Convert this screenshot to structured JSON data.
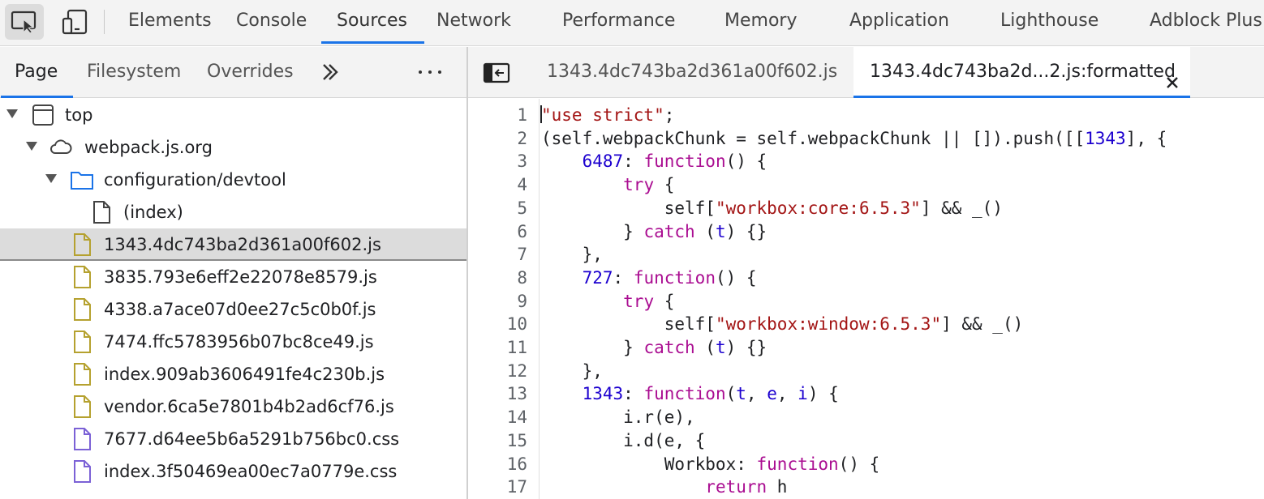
{
  "colors": {
    "accent": "#1a73e8",
    "js_file_icon": "#b5a12f",
    "css_file_icon": "#7b61d6",
    "folder_icon": "#1a73e8",
    "string": "#a31515",
    "keyword": "#aa0d91",
    "number": "#1c00cf"
  },
  "toolbar": {
    "inspect_icon": "inspect-element-icon",
    "device_icon": "device-toolbar-icon",
    "tabs": [
      "Elements",
      "Console",
      "Sources",
      "Network",
      "Performance",
      "Memory",
      "Application",
      "Lighthouse",
      "Adblock Plus"
    ],
    "active_tab": "Sources"
  },
  "navigator": {
    "tabs": [
      "Page",
      "Filesystem",
      "Overrides"
    ],
    "active_tab": "Page",
    "more_icon": "chevron-double-right-icon",
    "menu_icon": "more-horizontal-icon",
    "tree": [
      {
        "label": "top",
        "icon": "frame-icon",
        "depth": 0,
        "expanded": true
      },
      {
        "label": "webpack.js.org",
        "icon": "cloud-icon",
        "depth": 1,
        "expanded": true
      },
      {
        "label": "configuration/devtool",
        "icon": "folder-icon",
        "depth": 2,
        "expanded": true
      },
      {
        "label": "(index)",
        "icon": "document-icon",
        "depth": 3
      },
      {
        "label": "1343.4dc743ba2d361a00f602.js",
        "icon": "js-file-icon",
        "depth": 2,
        "selected": true
      },
      {
        "label": "3835.793e6eff2e22078e8579.js",
        "icon": "js-file-icon",
        "depth": 2
      },
      {
        "label": "4338.a7ace07d0ee27c5c0b0f.js",
        "icon": "js-file-icon",
        "depth": 2
      },
      {
        "label": "7474.ffc5783956b07bc8ce49.js",
        "icon": "js-file-icon",
        "depth": 2
      },
      {
        "label": "index.909ab3606491fe4c230b.js",
        "icon": "js-file-icon",
        "depth": 2
      },
      {
        "label": "vendor.6ca5e7801b4b2ad6cf76.js",
        "icon": "js-file-icon",
        "depth": 2
      },
      {
        "label": "7677.d64ee5b6a5291b756bc0.css",
        "icon": "css-file-icon",
        "depth": 2
      },
      {
        "label": "index.3f50469ea00ec7a0779e.css",
        "icon": "css-file-icon",
        "depth": 2
      }
    ]
  },
  "editor": {
    "toggle_icon": "toggle-navigator-icon",
    "tabs": [
      {
        "label": "1343.4dc743ba2d361a00f602.js",
        "active": false
      },
      {
        "label": "1343.4dc743ba2d...2.js:formatted",
        "active": true
      }
    ],
    "close_icon": "close-icon",
    "lines": [
      {
        "n": "1",
        "tokens": [
          [
            "str",
            "\"use strict\""
          ],
          [
            "plain",
            ";"
          ]
        ]
      },
      {
        "n": "2",
        "tokens": [
          [
            "plain",
            "(self.webpackChunk = self.webpackChunk || []).push([["
          ],
          [
            "num",
            "1343"
          ],
          [
            "plain",
            "], {"
          ]
        ]
      },
      {
        "n": "3",
        "tokens": [
          [
            "plain",
            "    "
          ],
          [
            "num",
            "6487"
          ],
          [
            "plain",
            ": "
          ],
          [
            "kw",
            "function"
          ],
          [
            "plain",
            "() {"
          ]
        ]
      },
      {
        "n": "4",
        "tokens": [
          [
            "plain",
            "        "
          ],
          [
            "kw",
            "try"
          ],
          [
            "plain",
            " {"
          ]
        ]
      },
      {
        "n": "5",
        "tokens": [
          [
            "plain",
            "            self["
          ],
          [
            "str",
            "\"workbox:core:6.5.3\""
          ],
          [
            "plain",
            "] && _()"
          ]
        ]
      },
      {
        "n": "6",
        "tokens": [
          [
            "plain",
            "        } "
          ],
          [
            "kw",
            "catch"
          ],
          [
            "plain",
            " ("
          ],
          [
            "var",
            "t"
          ],
          [
            "plain",
            ") {}"
          ]
        ]
      },
      {
        "n": "7",
        "tokens": [
          [
            "plain",
            "    },"
          ]
        ]
      },
      {
        "n": "8",
        "tokens": [
          [
            "plain",
            "    "
          ],
          [
            "num",
            "727"
          ],
          [
            "plain",
            ": "
          ],
          [
            "kw",
            "function"
          ],
          [
            "plain",
            "() {"
          ]
        ]
      },
      {
        "n": "9",
        "tokens": [
          [
            "plain",
            "        "
          ],
          [
            "kw",
            "try"
          ],
          [
            "plain",
            " {"
          ]
        ]
      },
      {
        "n": "10",
        "tokens": [
          [
            "plain",
            "            self["
          ],
          [
            "str",
            "\"workbox:window:6.5.3\""
          ],
          [
            "plain",
            "] && _()"
          ]
        ]
      },
      {
        "n": "11",
        "tokens": [
          [
            "plain",
            "        } "
          ],
          [
            "kw",
            "catch"
          ],
          [
            "plain",
            " ("
          ],
          [
            "var",
            "t"
          ],
          [
            "plain",
            ") {}"
          ]
        ]
      },
      {
        "n": "12",
        "tokens": [
          [
            "plain",
            "    },"
          ]
        ]
      },
      {
        "n": "13",
        "tokens": [
          [
            "plain",
            "    "
          ],
          [
            "num",
            "1343"
          ],
          [
            "plain",
            ": "
          ],
          [
            "kw",
            "function"
          ],
          [
            "plain",
            "("
          ],
          [
            "var",
            "t"
          ],
          [
            "plain",
            ", "
          ],
          [
            "var",
            "e"
          ],
          [
            "plain",
            ", "
          ],
          [
            "var",
            "i"
          ],
          [
            "plain",
            ") {"
          ]
        ]
      },
      {
        "n": "14",
        "tokens": [
          [
            "plain",
            "        i.r(e),"
          ]
        ]
      },
      {
        "n": "15",
        "tokens": [
          [
            "plain",
            "        i.d(e, {"
          ]
        ]
      },
      {
        "n": "16",
        "tokens": [
          [
            "plain",
            "            Workbox: "
          ],
          [
            "kw",
            "function"
          ],
          [
            "plain",
            "() {"
          ]
        ]
      },
      {
        "n": "17",
        "tokens": [
          [
            "plain",
            "                "
          ],
          [
            "kw",
            "return"
          ],
          [
            "plain",
            " h"
          ]
        ]
      }
    ]
  }
}
